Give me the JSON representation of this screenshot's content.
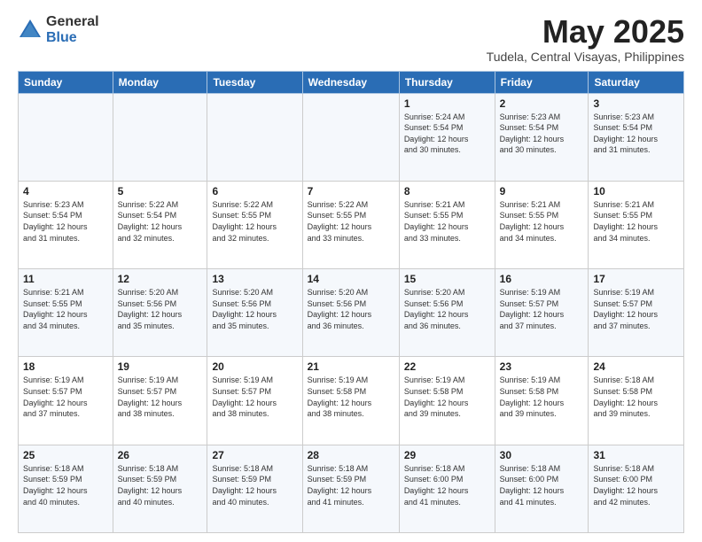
{
  "logo": {
    "general": "General",
    "blue": "Blue"
  },
  "header": {
    "title": "May 2025",
    "subtitle": "Tudela, Central Visayas, Philippines"
  },
  "weekdays": [
    "Sunday",
    "Monday",
    "Tuesday",
    "Wednesday",
    "Thursday",
    "Friday",
    "Saturday"
  ],
  "weeks": [
    [
      {
        "day": "",
        "info": ""
      },
      {
        "day": "",
        "info": ""
      },
      {
        "day": "",
        "info": ""
      },
      {
        "day": "",
        "info": ""
      },
      {
        "day": "1",
        "info": "Sunrise: 5:24 AM\nSunset: 5:54 PM\nDaylight: 12 hours\nand 30 minutes."
      },
      {
        "day": "2",
        "info": "Sunrise: 5:23 AM\nSunset: 5:54 PM\nDaylight: 12 hours\nand 30 minutes."
      },
      {
        "day": "3",
        "info": "Sunrise: 5:23 AM\nSunset: 5:54 PM\nDaylight: 12 hours\nand 31 minutes."
      }
    ],
    [
      {
        "day": "4",
        "info": "Sunrise: 5:23 AM\nSunset: 5:54 PM\nDaylight: 12 hours\nand 31 minutes."
      },
      {
        "day": "5",
        "info": "Sunrise: 5:22 AM\nSunset: 5:54 PM\nDaylight: 12 hours\nand 32 minutes."
      },
      {
        "day": "6",
        "info": "Sunrise: 5:22 AM\nSunset: 5:55 PM\nDaylight: 12 hours\nand 32 minutes."
      },
      {
        "day": "7",
        "info": "Sunrise: 5:22 AM\nSunset: 5:55 PM\nDaylight: 12 hours\nand 33 minutes."
      },
      {
        "day": "8",
        "info": "Sunrise: 5:21 AM\nSunset: 5:55 PM\nDaylight: 12 hours\nand 33 minutes."
      },
      {
        "day": "9",
        "info": "Sunrise: 5:21 AM\nSunset: 5:55 PM\nDaylight: 12 hours\nand 34 minutes."
      },
      {
        "day": "10",
        "info": "Sunrise: 5:21 AM\nSunset: 5:55 PM\nDaylight: 12 hours\nand 34 minutes."
      }
    ],
    [
      {
        "day": "11",
        "info": "Sunrise: 5:21 AM\nSunset: 5:55 PM\nDaylight: 12 hours\nand 34 minutes."
      },
      {
        "day": "12",
        "info": "Sunrise: 5:20 AM\nSunset: 5:56 PM\nDaylight: 12 hours\nand 35 minutes."
      },
      {
        "day": "13",
        "info": "Sunrise: 5:20 AM\nSunset: 5:56 PM\nDaylight: 12 hours\nand 35 minutes."
      },
      {
        "day": "14",
        "info": "Sunrise: 5:20 AM\nSunset: 5:56 PM\nDaylight: 12 hours\nand 36 minutes."
      },
      {
        "day": "15",
        "info": "Sunrise: 5:20 AM\nSunset: 5:56 PM\nDaylight: 12 hours\nand 36 minutes."
      },
      {
        "day": "16",
        "info": "Sunrise: 5:19 AM\nSunset: 5:57 PM\nDaylight: 12 hours\nand 37 minutes."
      },
      {
        "day": "17",
        "info": "Sunrise: 5:19 AM\nSunset: 5:57 PM\nDaylight: 12 hours\nand 37 minutes."
      }
    ],
    [
      {
        "day": "18",
        "info": "Sunrise: 5:19 AM\nSunset: 5:57 PM\nDaylight: 12 hours\nand 37 minutes."
      },
      {
        "day": "19",
        "info": "Sunrise: 5:19 AM\nSunset: 5:57 PM\nDaylight: 12 hours\nand 38 minutes."
      },
      {
        "day": "20",
        "info": "Sunrise: 5:19 AM\nSunset: 5:57 PM\nDaylight: 12 hours\nand 38 minutes."
      },
      {
        "day": "21",
        "info": "Sunrise: 5:19 AM\nSunset: 5:58 PM\nDaylight: 12 hours\nand 38 minutes."
      },
      {
        "day": "22",
        "info": "Sunrise: 5:19 AM\nSunset: 5:58 PM\nDaylight: 12 hours\nand 39 minutes."
      },
      {
        "day": "23",
        "info": "Sunrise: 5:19 AM\nSunset: 5:58 PM\nDaylight: 12 hours\nand 39 minutes."
      },
      {
        "day": "24",
        "info": "Sunrise: 5:18 AM\nSunset: 5:58 PM\nDaylight: 12 hours\nand 39 minutes."
      }
    ],
    [
      {
        "day": "25",
        "info": "Sunrise: 5:18 AM\nSunset: 5:59 PM\nDaylight: 12 hours\nand 40 minutes."
      },
      {
        "day": "26",
        "info": "Sunrise: 5:18 AM\nSunset: 5:59 PM\nDaylight: 12 hours\nand 40 minutes."
      },
      {
        "day": "27",
        "info": "Sunrise: 5:18 AM\nSunset: 5:59 PM\nDaylight: 12 hours\nand 40 minutes."
      },
      {
        "day": "28",
        "info": "Sunrise: 5:18 AM\nSunset: 5:59 PM\nDaylight: 12 hours\nand 41 minutes."
      },
      {
        "day": "29",
        "info": "Sunrise: 5:18 AM\nSunset: 6:00 PM\nDaylight: 12 hours\nand 41 minutes."
      },
      {
        "day": "30",
        "info": "Sunrise: 5:18 AM\nSunset: 6:00 PM\nDaylight: 12 hours\nand 41 minutes."
      },
      {
        "day": "31",
        "info": "Sunrise: 5:18 AM\nSunset: 6:00 PM\nDaylight: 12 hours\nand 42 minutes."
      }
    ]
  ]
}
